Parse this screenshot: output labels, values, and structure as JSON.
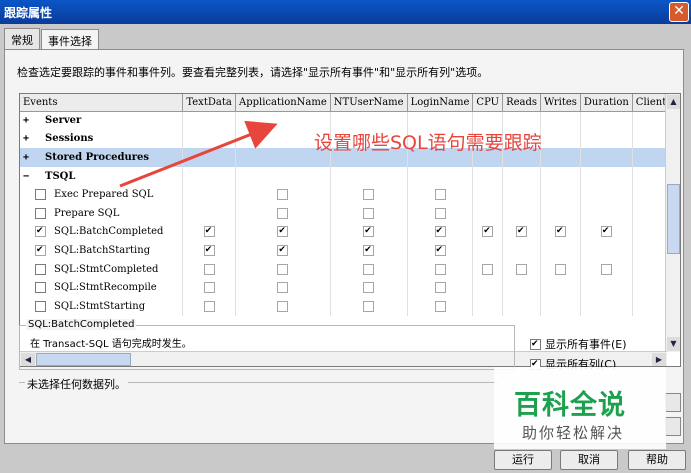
{
  "window": {
    "title": "跟踪属性",
    "close_glyph": "✕"
  },
  "tabs": [
    {
      "label": "常规",
      "active": false
    },
    {
      "label": "事件选择",
      "active": true
    }
  ],
  "instruction": "检查选定要跟踪的事件和事件列。要查看完整列表，请选择\"显示所有事件\"和\"显示所有列\"选项。",
  "columns": [
    "Events",
    "TextData",
    "ApplicationName",
    "NTUserName",
    "LoginName",
    "CPU",
    "Reads",
    "Writes",
    "Duration",
    "ClientP"
  ],
  "categories": [
    {
      "expander": "+",
      "label": "Server"
    },
    {
      "expander": "+",
      "label": "Sessions"
    },
    {
      "expander": "+",
      "label": "Stored Procedures"
    },
    {
      "expander": "−",
      "label": "TSQL"
    }
  ],
  "events": [
    {
      "label": "Exec Prepared SQL",
      "checked": false,
      "cells": [
        "none",
        "off",
        "off",
        "off",
        "none",
        "none",
        "none",
        "none",
        "none"
      ]
    },
    {
      "label": "Prepare SQL",
      "checked": false,
      "cells": [
        "none",
        "off",
        "off",
        "off",
        "none",
        "none",
        "none",
        "none",
        "none"
      ]
    },
    {
      "label": "SQL:BatchCompleted",
      "checked": true,
      "cells": [
        "on",
        "on",
        "on",
        "on",
        "on",
        "on",
        "on",
        "on",
        "none"
      ]
    },
    {
      "label": "SQL:BatchStarting",
      "checked": true,
      "cells": [
        "on",
        "on",
        "on",
        "on",
        "none",
        "none",
        "none",
        "none",
        "none"
      ]
    },
    {
      "label": "SQL:StmtCompleted",
      "checked": false,
      "cells": [
        "off",
        "off",
        "off",
        "off",
        "off",
        "off",
        "off",
        "off",
        "none"
      ]
    },
    {
      "label": "SQL:StmtRecompile",
      "checked": false,
      "cells": [
        "off",
        "off",
        "off",
        "off",
        "none",
        "none",
        "none",
        "none",
        "none"
      ]
    },
    {
      "label": "SQL:StmtStarting",
      "checked": false,
      "cells": [
        "off",
        "off",
        "off",
        "off",
        "none",
        "none",
        "none",
        "none",
        "none"
      ]
    }
  ],
  "description": {
    "title": "SQL:BatchCompleted",
    "text": "在 Transact-SQL 语句完成时发生。"
  },
  "options": [
    {
      "label": "显示所有事件(E)",
      "checked": true
    },
    {
      "label": "显示所有列(C)",
      "checked": true
    }
  ],
  "filter_label": "未选择任何数据列。",
  "buttons": {
    "run": "运行",
    "cancel": "取消",
    "help": "帮助"
  },
  "annotation": {
    "text": "设置哪些SQL语句需要跟踪",
    "color": "#e8453c"
  },
  "watermark": {
    "title": "百科全说",
    "subtitle": "助你轻松解决",
    "color": "#1ea14f"
  }
}
